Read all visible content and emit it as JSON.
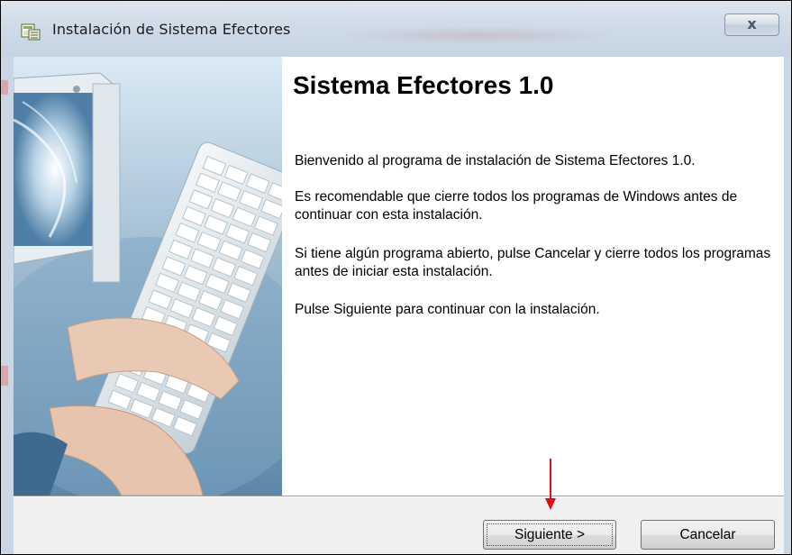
{
  "window": {
    "title": "Instalación de Sistema Efectores",
    "close_label": "x"
  },
  "content": {
    "heading": "Sistema Efectores 1.0",
    "paragraphs": [
      "Bienvenido al programa de instalación de Sistema Efectores 1.0.",
      "Es recomendable que cierre todos los programas de Windows antes de continuar con esta instalación.",
      "Si tiene algún programa abierto, pulse Cancelar y cierre todos los programas antes de iniciar esta instalación.",
      "Pulse Siguiente para continuar con la instalación."
    ]
  },
  "buttons": {
    "next_label": "Siguiente >",
    "cancel_label": "Cancelar"
  },
  "annotation": {
    "arrow_color": "#e01010"
  },
  "icons": [
    "installer-app-icon",
    "close-icon",
    "down-arrow-icon"
  ],
  "colors": {
    "titlebar": "#cfdbe7",
    "content_bg": "#ffffff",
    "panel_bg": "#f0f0f0"
  }
}
